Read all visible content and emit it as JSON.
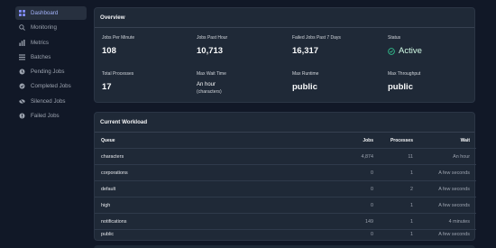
{
  "sidebar": {
    "items": [
      {
        "label": "Dashboard",
        "icon": "grid-icon",
        "active": true
      },
      {
        "label": "Monitoring",
        "icon": "search-icon",
        "active": false
      },
      {
        "label": "Metrics",
        "icon": "bar-chart-icon",
        "active": false
      },
      {
        "label": "Batches",
        "icon": "list-icon",
        "active": false
      },
      {
        "label": "Pending Jobs",
        "icon": "clock-icon",
        "active": false
      },
      {
        "label": "Completed Jobs",
        "icon": "check-circle-icon",
        "active": false
      },
      {
        "label": "Silenced Jobs",
        "icon": "eye-slash-icon",
        "active": false
      },
      {
        "label": "Failed Jobs",
        "icon": "alert-circle-icon",
        "active": false
      }
    ]
  },
  "overview": {
    "title": "Overview",
    "stats": [
      {
        "label": "Jobs Per Minute",
        "value": "108"
      },
      {
        "label": "Jobs Past Hour",
        "value": "10,713"
      },
      {
        "label": "Failed Jobs Past 7 Days",
        "value": "16,317"
      },
      {
        "label": "Status",
        "value": "Active"
      },
      {
        "label": "Total Processes",
        "value": "17"
      },
      {
        "label": "Max Wait Time",
        "value": "An hour",
        "sub": "(characters)"
      },
      {
        "label": "Max Runtime",
        "value": "public"
      },
      {
        "label": "Max Throughput",
        "value": "public"
      }
    ]
  },
  "workload": {
    "title": "Current Workload",
    "columns": {
      "queue": "Queue",
      "jobs": "Jobs",
      "processes": "Processes",
      "wait": "Wait"
    },
    "rows": [
      {
        "queue": "characters",
        "jobs": "4,874",
        "processes": "11",
        "wait": "An hour"
      },
      {
        "queue": "corporations",
        "jobs": "0",
        "processes": "1",
        "wait": "A few seconds"
      },
      {
        "queue": "default",
        "jobs": "0",
        "processes": "2",
        "wait": "A few seconds"
      },
      {
        "queue": "high",
        "jobs": "0",
        "processes": "1",
        "wait": "A few seconds"
      },
      {
        "queue": "notifications",
        "jobs": "149",
        "processes": "1",
        "wait": "4 minutes"
      },
      {
        "queue": "public",
        "jobs": "0",
        "processes": "1",
        "wait": "A few seconds"
      }
    ]
  },
  "colors": {
    "accent": "#818cf8",
    "status_active": "#34d399",
    "background": "#111827",
    "card": "#1f2937"
  }
}
